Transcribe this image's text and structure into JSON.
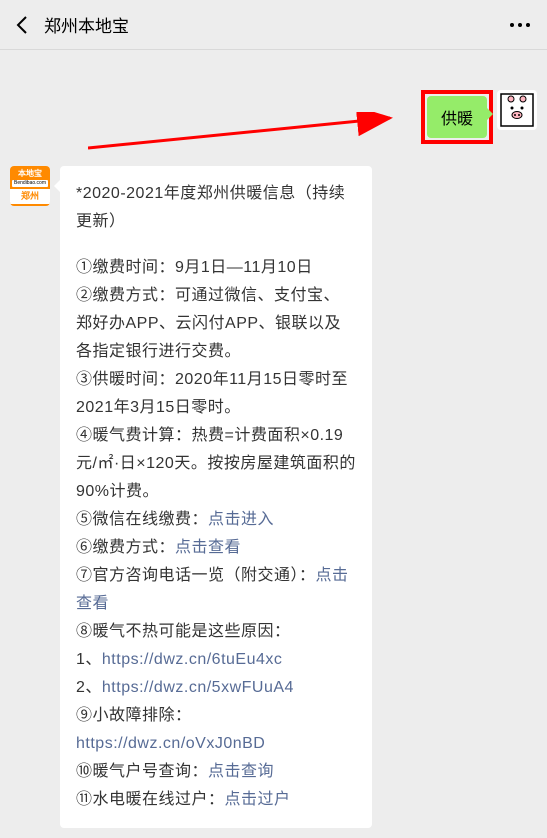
{
  "header": {
    "title": "郑州本地宝"
  },
  "sent_message": {
    "text": "供暖"
  },
  "avatar_left": {
    "line1": "本地宝",
    "line2": "Bendibao.com",
    "line3": "郑州"
  },
  "article": {
    "title": "*2020-2021年度郑州供暖信息（持续更新）",
    "item1": "①缴费时间：9月1日—11月10日",
    "item2": "②缴费方式：可通过微信、支付宝、郑好办APP、云闪付APP、银联以及各指定银行进行交费。",
    "item3": "③供暖时间：2020年11月15日零时至2021年3月15日零时。",
    "item4": "④暖气费计算：热费=计费面积×0.19元/㎡·日×120天。按按房屋建筑面积的90%计费。",
    "item5_prefix": "⑤微信在线缴费：",
    "item5_link": "点击进入",
    "item6_prefix": "⑥缴费方式：",
    "item6_link": "点击查看",
    "item7_prefix": "⑦官方咨询电话一览（附交通）：",
    "item7_link": "点击查看",
    "item8": "⑧暖气不热可能是这些原因：",
    "item8_1_prefix": "1、",
    "item8_1_link": "https://dwz.cn/6tuEu4xc",
    "item8_2_prefix": "2、",
    "item8_2_link": "https://dwz.cn/5xwFUuA4",
    "item9_prefix": "⑨小故障排除：",
    "item9_link": "https://dwz.cn/oVxJ0nBD",
    "item10_prefix": "⑩暖气户号查询：",
    "item10_link": "点击查询",
    "item11_prefix": "⑪水电暖在线过户：",
    "item11_link": "点击过户"
  }
}
